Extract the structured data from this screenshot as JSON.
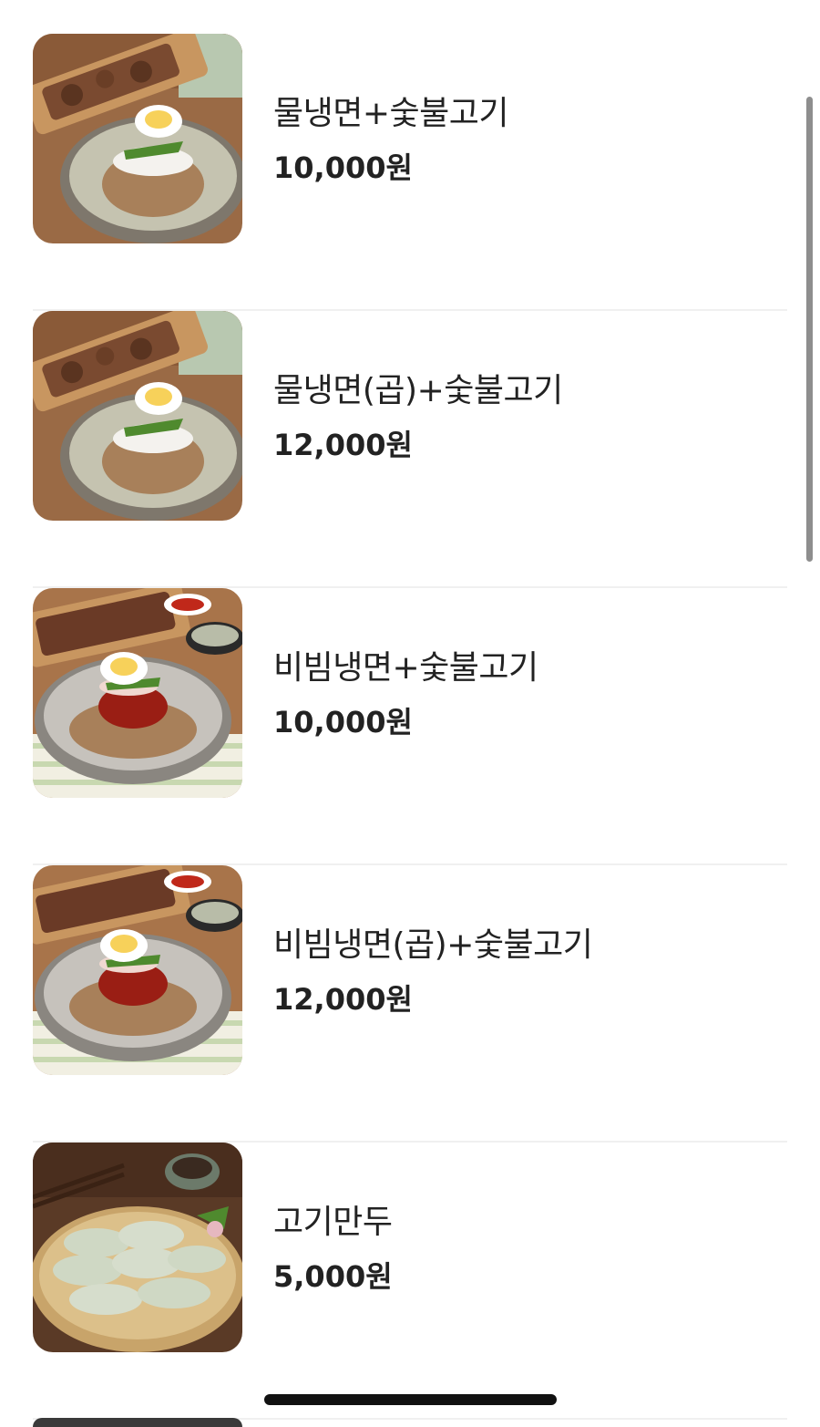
{
  "menu": {
    "items": [
      {
        "name": "물냉면+숯불고기",
        "price": "10,000원",
        "image": "mul-naengmyeon-bulgogi-photo"
      },
      {
        "name": "물냉면(곱)+숯불고기",
        "price": "12,000원",
        "image": "mul-naengmyeon-bulgogi-photo"
      },
      {
        "name": "비빔냉면+숯불고기",
        "price": "10,000원",
        "image": "bibim-naengmyeon-bulgogi-photo"
      },
      {
        "name": "비빔냉면(곱)+숯불고기",
        "price": "12,000원",
        "image": "bibim-naengmyeon-bulgogi-photo"
      },
      {
        "name": "고기만두",
        "price": "5,000원",
        "image": "gogi-mandu-photo"
      }
    ]
  },
  "colors": {
    "text": "#222222",
    "divider": "#f0f0f0",
    "scrollbar": "#8e8e8e",
    "home_indicator": "#111111"
  }
}
